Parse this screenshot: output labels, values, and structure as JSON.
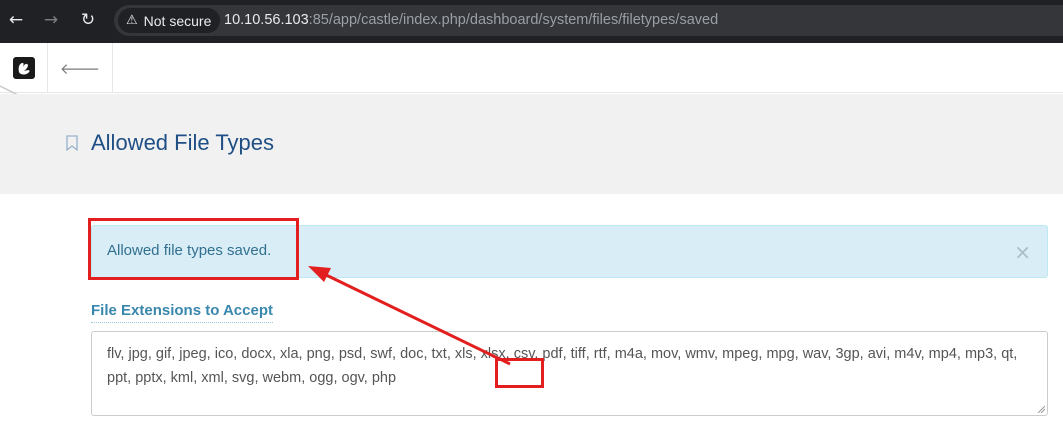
{
  "browser": {
    "back_icon": "←",
    "forward_icon": "→",
    "reload_icon": "↻",
    "security_warning_icon": "⚠",
    "security_label": "Not secure",
    "url_host": "10.10.56.103",
    "url_rest": ":85/app/castle/index.php/dashboard/system/files/filetypes/saved"
  },
  "toolbar": {
    "back_icon": "🡐"
  },
  "page": {
    "title": "Allowed File Types"
  },
  "alert": {
    "message": "Allowed file types saved.",
    "close_symbol": "×"
  },
  "form": {
    "label": "File Extensions to Accept",
    "value": "flv, jpg, gif, jpeg, ico, docx, xla, png, psd, swf, doc, txt, xls, xlsx, csv, pdf, tiff, rtf, m4a, mov, wmv, mpeg, mpg, wav, 3gp, avi, m4v, mp4, mp3, qt, ppt, pptx, kml, xml, svg, webm, ogg, ogv, php"
  },
  "colors": {
    "annotation": "#e31e1e",
    "title": "#1f4f85",
    "alert_bg": "#d9edf7",
    "alert_text": "#31708f",
    "label": "#3a87ad"
  }
}
